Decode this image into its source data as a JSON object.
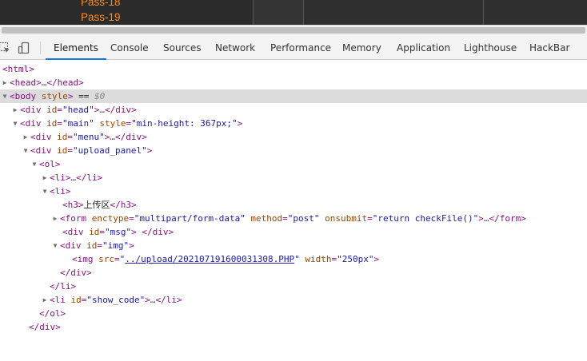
{
  "page_preview": {
    "menu_items": [
      "Pass-18",
      "Pass-19"
    ]
  },
  "toolbar": {
    "tabs": [
      "Elements",
      "Console",
      "Sources",
      "Network",
      "Performance",
      "Memory",
      "Application",
      "Lighthouse",
      "HackBar"
    ],
    "active_tab": "Elements"
  },
  "tree": {
    "r0": {
      "open": "<html>"
    },
    "r1": {
      "open": "<head>",
      "ellipsis": "…",
      "close": "</head>"
    },
    "r2": {
      "tag": "<body",
      "attr": " style",
      "close": ">",
      "suffix": " == ",
      "dollar": "$0"
    },
    "r3": {
      "tag": "<div",
      "attr": " id",
      "eq": "=",
      "val": "\"head\"",
      "close": ">",
      "ellipsis": "…",
      "end": "</div>"
    },
    "r4": {
      "tag": "<div",
      "attr1": " id",
      "eq1": "=",
      "val1": "\"main\"",
      "attr2": " style",
      "eq2": "=",
      "val2": "\"min-height: 367px;\"",
      "close": ">"
    },
    "r5": {
      "tag": "<div",
      "attr": " id",
      "eq": "=",
      "val": "\"menu\"",
      "close": ">",
      "ellipsis": "…",
      "end": "</div>"
    },
    "r6": {
      "tag": "<div",
      "attr": " id",
      "eq": "=",
      "val": "\"upload_panel\"",
      "close": ">"
    },
    "r7": {
      "open": "<ol>"
    },
    "r8": {
      "open": "<li>",
      "ellipsis": "…",
      "close": "</li>"
    },
    "r9": {
      "open": "<li>"
    },
    "r10": {
      "open": "<h3>",
      "text": "上传区",
      "close": "</h3>"
    },
    "r11": {
      "tag": "<form",
      "attr1": " enctype",
      "eq1": "=",
      "val1": "\"multipart/form-data\"",
      "attr2": " method",
      "eq2": "=",
      "val2": "\"post\"",
      "attr3": " onsubmit",
      "eq3": "=",
      "val3": "\"return checkFile()\"",
      "close": ">",
      "ellipsis": "…",
      "end": "</form>"
    },
    "r12": {
      "tag": "<div",
      "attr": " id",
      "eq": "=",
      "val": "\"msg\"",
      "close": ">",
      "end": " </div>"
    },
    "r13": {
      "tag": "<div",
      "attr": " id",
      "eq": "=",
      "val": "\"img\"",
      "close": ">"
    },
    "r14": {
      "tag": "<img",
      "attr1": " src",
      "eq1": "=",
      "q1": "\"",
      "link": "../upload/202107191600031308.PHP",
      "q2": "\"",
      "attr2": " width",
      "eq2": "=",
      "val2": "\"250px\"",
      "close": ">"
    },
    "r15": {
      "close": "</div>"
    },
    "r16": {
      "close": "</li>"
    },
    "r17": {
      "tag": "<li",
      "attr": " id",
      "eq": "=",
      "val": "\"show_code\"",
      "close": ">",
      "ellipsis": "…",
      "end": "</li>"
    },
    "r18": {
      "close": "</ol>"
    },
    "r19": {
      "close": "</div>"
    }
  },
  "colors": {
    "menu_link": "#ff8c1a",
    "tag": "#881280",
    "attr": "#994500",
    "value": "#1a1aa6",
    "active_tab_underline": "#1a73e8",
    "selected_row": "#dcdcdc"
  },
  "icons": {
    "inspect": "inspect-element-icon",
    "device": "device-toolbar-icon"
  }
}
